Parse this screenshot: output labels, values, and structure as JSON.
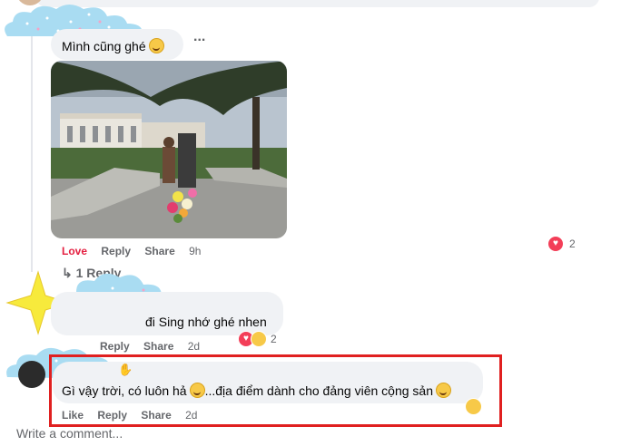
{
  "comment1": {
    "text": "Mình cũng ghé",
    "more_label": "...",
    "actions": {
      "love": "Love",
      "reply": "Reply",
      "share": "Share",
      "time": "9h"
    },
    "reaction_count": "2",
    "replies_link": "1 Reply"
  },
  "comment2": {
    "text": "đi Sing nhớ ghé nhen",
    "actions": {
      "reply": "Reply",
      "share": "Share",
      "time": "2d"
    },
    "reaction_count": "2"
  },
  "comment3": {
    "text": "Gì vậy trời, có luôn hả",
    "text2": "...địa điểm dành cho đảng viên cộng sản",
    "actions": {
      "like": "Like",
      "reply": "Reply",
      "share": "Share",
      "time": "2d"
    }
  },
  "composer": {
    "placeholder": "Write a comment..."
  },
  "colors": {
    "highlight": "#e02020",
    "love": "#f33e58",
    "muted": "#65676b"
  }
}
